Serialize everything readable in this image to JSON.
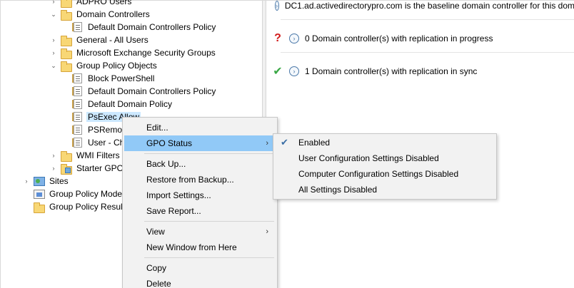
{
  "tree": {
    "items": [
      {
        "label": "ADPRO Users"
      },
      {
        "label": "Domain Controllers"
      },
      {
        "label": "Default Domain Controllers Policy"
      },
      {
        "label": "General - All Users"
      },
      {
        "label": "Microsoft Exchange Security Groups"
      },
      {
        "label": "Group Policy Objects"
      },
      {
        "label": "Block PowerShell"
      },
      {
        "label": "Default Domain Controllers Policy"
      },
      {
        "label": "Default Domain Policy"
      },
      {
        "label": "PsExec Allow"
      },
      {
        "label": "PSRemot"
      },
      {
        "label": "User - Ch"
      },
      {
        "label": "WMI Filters"
      },
      {
        "label": "Starter GPOs"
      },
      {
        "label": "Sites"
      },
      {
        "label": "Group Policy Mode"
      },
      {
        "label": "Group Policy Result"
      }
    ]
  },
  "status": {
    "rows": [
      {
        "text": "DC1.ad.activedirectorypro.com is the baseline domain controller for this dom"
      },
      {
        "icon": "?",
        "text": "0 Domain controller(s) with replication in progress"
      },
      {
        "icon": "✔",
        "text": "1 Domain controller(s) with replication in sync"
      }
    ]
  },
  "context_menu": {
    "items": [
      {
        "label": "Edit..."
      },
      {
        "label": "GPO Status",
        "submenu_arrow": "›"
      },
      {
        "label": "Back Up..."
      },
      {
        "label": "Restore from Backup..."
      },
      {
        "label": "Import Settings..."
      },
      {
        "label": "Save Report..."
      },
      {
        "label": "View",
        "submenu_arrow": "›"
      },
      {
        "label": "New Window from Here"
      },
      {
        "label": "Copy"
      },
      {
        "label": "Delete"
      }
    ]
  },
  "gpo_status_submenu": {
    "checked_mark": "✔",
    "items": [
      {
        "label": "Enabled"
      },
      {
        "label": "User Configuration Settings Disabled"
      },
      {
        "label": "Computer Configuration Settings Disabled"
      },
      {
        "label": "All Settings Disabled"
      }
    ]
  },
  "colors": {
    "highlight": "#91c9f7",
    "selection": "#cce8ff",
    "menu_background": "#f2f2f2",
    "question_icon": "#d11a1a",
    "check_icon": "#3aa845",
    "info_icon": "#4a78a8"
  }
}
